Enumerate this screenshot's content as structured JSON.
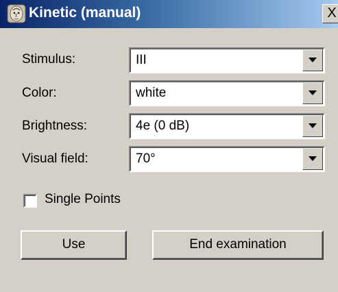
{
  "window": {
    "title": "Kinetic (manual)",
    "close_label": "X"
  },
  "form": {
    "stimulus": {
      "label": "Stimulus:",
      "value": "III"
    },
    "color": {
      "label": "Color:",
      "value": "white"
    },
    "brightness": {
      "label": "Brightness:",
      "value": "4e (0 dB)"
    },
    "visual_field": {
      "label": "Visual field:",
      "value": "70°"
    }
  },
  "options": {
    "single_points_label": "Single Points",
    "single_points_checked": false
  },
  "buttons": {
    "use_label": "Use",
    "end_label": "End examination"
  },
  "icons": {
    "title_icon": "face-profile-icon",
    "dropdown_icon": "chevron-down-icon"
  },
  "colors": {
    "titlebar_start": "#0a246a",
    "titlebar_end": "#a6caf0",
    "face": "#d4d0c8"
  }
}
